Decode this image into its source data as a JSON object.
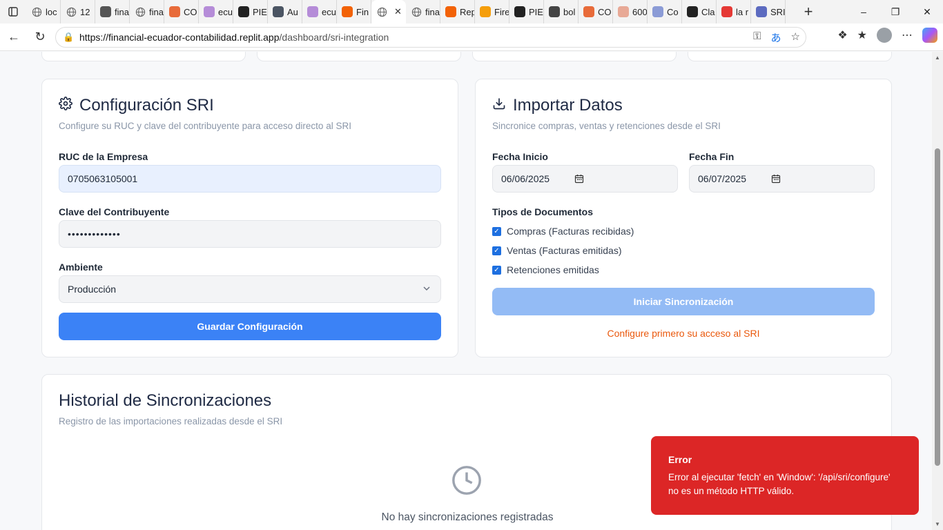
{
  "browser": {
    "tabs": [
      {
        "label": "loc",
        "icon": "globe-icon",
        "color": "#666666"
      },
      {
        "label": "12",
        "icon": "globe-icon",
        "color": "#666666"
      },
      {
        "label": "fina",
        "icon": "triangle-icon",
        "color": "#555555"
      },
      {
        "label": "fina",
        "icon": "globe-icon",
        "color": "#666666"
      },
      {
        "label": "CO",
        "icon": "bolt-icon",
        "color": "#e86b3a"
      },
      {
        "label": "ecu",
        "icon": "purple-icon",
        "color": "#b58cd8"
      },
      {
        "label": "PIE",
        "icon": "github-icon",
        "color": "#222222"
      },
      {
        "label": "Au",
        "icon": "activity-icon",
        "color": "#4b5563"
      },
      {
        "label": "ecu",
        "icon": "purple-icon",
        "color": "#b58cd8"
      },
      {
        "label": "Fin",
        "icon": "replit-icon",
        "color": "#f26207"
      },
      {
        "label": "",
        "icon": "globe-icon",
        "color": "#666666",
        "active": true
      },
      {
        "label": "fina",
        "icon": "globe-icon",
        "color": "#666666"
      },
      {
        "label": "Rep",
        "icon": "replit-icon",
        "color": "#f26207"
      },
      {
        "label": "Fire",
        "icon": "flame-icon",
        "color": "#f59e0b"
      },
      {
        "label": "PIE",
        "icon": "github-icon",
        "color": "#222222"
      },
      {
        "label": "bol",
        "icon": "b-icon",
        "color": "#444444"
      },
      {
        "label": "CO",
        "icon": "bolt-icon",
        "color": "#e86b3a"
      },
      {
        "label": "600",
        "icon": "circle-icon",
        "color": "#e8a996"
      },
      {
        "label": "Co",
        "icon": "wave-icon",
        "color": "#8b9bd6"
      },
      {
        "label": "Cla",
        "icon": "github-icon",
        "color": "#222222"
      },
      {
        "label": "la r",
        "icon": "youtube-icon",
        "color": "#e53935"
      },
      {
        "label": "SRI",
        "icon": "sri-icon",
        "color": "#5c6bc0"
      }
    ],
    "url_host": "https://financial-ecuador-contabilidad.replit.app",
    "url_path": "/dashboard/sri-integration"
  },
  "config_card": {
    "title": "Configuración SRI",
    "subtitle": "Configure su RUC y clave del contribuyente para acceso directo al SRI",
    "ruc_label": "RUC de la Empresa",
    "ruc_value": "0705063105001",
    "clave_label": "Clave del Contribuyente",
    "clave_value": "•••••••••••••",
    "ambiente_label": "Ambiente",
    "ambiente_value": "Producción",
    "save_button": "Guardar Configuración"
  },
  "import_card": {
    "title": "Importar Datos",
    "subtitle": "Sincronice compras, ventas y retenciones desde el SRI",
    "fecha_inicio_label": "Fecha Inicio",
    "fecha_inicio_value": "06/06/2025",
    "fecha_fin_label": "Fecha Fin",
    "fecha_fin_value": "06/07/2025",
    "doc_types_label": "Tipos de Documentos",
    "doc_types": [
      {
        "label": "Compras (Facturas recibidas)",
        "checked": true
      },
      {
        "label": "Ventas (Facturas emitidas)",
        "checked": true
      },
      {
        "label": "Retenciones emitidas",
        "checked": true
      }
    ],
    "sync_button": "Iniciar Sincronización",
    "warning": "Configure primero su acceso al SRI"
  },
  "history_card": {
    "title": "Historial de Sincronizaciones",
    "subtitle": "Registro de las importaciones realizadas desde el SRI",
    "empty_text": "No hay sincronizaciones registradas"
  },
  "toast": {
    "title": "Error",
    "message": "Error al ejecutar 'fetch' en 'Window': '/api/sri/configure' no es un método HTTP válido."
  },
  "colors": {
    "primary": "#3b82f6",
    "primary_disabled": "#93bbf5",
    "warning": "#ea580c",
    "error": "#dc2626"
  }
}
